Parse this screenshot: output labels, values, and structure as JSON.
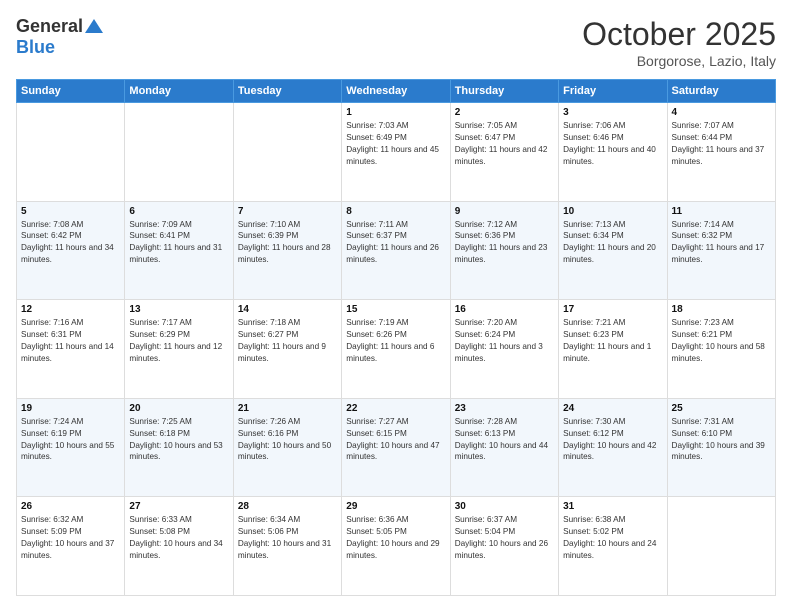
{
  "header": {
    "logo_general": "General",
    "logo_blue": "Blue",
    "month": "October 2025",
    "location": "Borgorose, Lazio, Italy"
  },
  "days_of_week": [
    "Sunday",
    "Monday",
    "Tuesday",
    "Wednesday",
    "Thursday",
    "Friday",
    "Saturday"
  ],
  "weeks": [
    [
      {
        "day": "",
        "info": ""
      },
      {
        "day": "",
        "info": ""
      },
      {
        "day": "",
        "info": ""
      },
      {
        "day": "1",
        "info": "Sunrise: 7:03 AM\nSunset: 6:49 PM\nDaylight: 11 hours and 45 minutes."
      },
      {
        "day": "2",
        "info": "Sunrise: 7:05 AM\nSunset: 6:47 PM\nDaylight: 11 hours and 42 minutes."
      },
      {
        "day": "3",
        "info": "Sunrise: 7:06 AM\nSunset: 6:46 PM\nDaylight: 11 hours and 40 minutes."
      },
      {
        "day": "4",
        "info": "Sunrise: 7:07 AM\nSunset: 6:44 PM\nDaylight: 11 hours and 37 minutes."
      }
    ],
    [
      {
        "day": "5",
        "info": "Sunrise: 7:08 AM\nSunset: 6:42 PM\nDaylight: 11 hours and 34 minutes."
      },
      {
        "day": "6",
        "info": "Sunrise: 7:09 AM\nSunset: 6:41 PM\nDaylight: 11 hours and 31 minutes."
      },
      {
        "day": "7",
        "info": "Sunrise: 7:10 AM\nSunset: 6:39 PM\nDaylight: 11 hours and 28 minutes."
      },
      {
        "day": "8",
        "info": "Sunrise: 7:11 AM\nSunset: 6:37 PM\nDaylight: 11 hours and 26 minutes."
      },
      {
        "day": "9",
        "info": "Sunrise: 7:12 AM\nSunset: 6:36 PM\nDaylight: 11 hours and 23 minutes."
      },
      {
        "day": "10",
        "info": "Sunrise: 7:13 AM\nSunset: 6:34 PM\nDaylight: 11 hours and 20 minutes."
      },
      {
        "day": "11",
        "info": "Sunrise: 7:14 AM\nSunset: 6:32 PM\nDaylight: 11 hours and 17 minutes."
      }
    ],
    [
      {
        "day": "12",
        "info": "Sunrise: 7:16 AM\nSunset: 6:31 PM\nDaylight: 11 hours and 14 minutes."
      },
      {
        "day": "13",
        "info": "Sunrise: 7:17 AM\nSunset: 6:29 PM\nDaylight: 11 hours and 12 minutes."
      },
      {
        "day": "14",
        "info": "Sunrise: 7:18 AM\nSunset: 6:27 PM\nDaylight: 11 hours and 9 minutes."
      },
      {
        "day": "15",
        "info": "Sunrise: 7:19 AM\nSunset: 6:26 PM\nDaylight: 11 hours and 6 minutes."
      },
      {
        "day": "16",
        "info": "Sunrise: 7:20 AM\nSunset: 6:24 PM\nDaylight: 11 hours and 3 minutes."
      },
      {
        "day": "17",
        "info": "Sunrise: 7:21 AM\nSunset: 6:23 PM\nDaylight: 11 hours and 1 minute."
      },
      {
        "day": "18",
        "info": "Sunrise: 7:23 AM\nSunset: 6:21 PM\nDaylight: 10 hours and 58 minutes."
      }
    ],
    [
      {
        "day": "19",
        "info": "Sunrise: 7:24 AM\nSunset: 6:19 PM\nDaylight: 10 hours and 55 minutes."
      },
      {
        "day": "20",
        "info": "Sunrise: 7:25 AM\nSunset: 6:18 PM\nDaylight: 10 hours and 53 minutes."
      },
      {
        "day": "21",
        "info": "Sunrise: 7:26 AM\nSunset: 6:16 PM\nDaylight: 10 hours and 50 minutes."
      },
      {
        "day": "22",
        "info": "Sunrise: 7:27 AM\nSunset: 6:15 PM\nDaylight: 10 hours and 47 minutes."
      },
      {
        "day": "23",
        "info": "Sunrise: 7:28 AM\nSunset: 6:13 PM\nDaylight: 10 hours and 44 minutes."
      },
      {
        "day": "24",
        "info": "Sunrise: 7:30 AM\nSunset: 6:12 PM\nDaylight: 10 hours and 42 minutes."
      },
      {
        "day": "25",
        "info": "Sunrise: 7:31 AM\nSunset: 6:10 PM\nDaylight: 10 hours and 39 minutes."
      }
    ],
    [
      {
        "day": "26",
        "info": "Sunrise: 6:32 AM\nSunset: 5:09 PM\nDaylight: 10 hours and 37 minutes."
      },
      {
        "day": "27",
        "info": "Sunrise: 6:33 AM\nSunset: 5:08 PM\nDaylight: 10 hours and 34 minutes."
      },
      {
        "day": "28",
        "info": "Sunrise: 6:34 AM\nSunset: 5:06 PM\nDaylight: 10 hours and 31 minutes."
      },
      {
        "day": "29",
        "info": "Sunrise: 6:36 AM\nSunset: 5:05 PM\nDaylight: 10 hours and 29 minutes."
      },
      {
        "day": "30",
        "info": "Sunrise: 6:37 AM\nSunset: 5:04 PM\nDaylight: 10 hours and 26 minutes."
      },
      {
        "day": "31",
        "info": "Sunrise: 6:38 AM\nSunset: 5:02 PM\nDaylight: 10 hours and 24 minutes."
      },
      {
        "day": "",
        "info": ""
      }
    ]
  ]
}
